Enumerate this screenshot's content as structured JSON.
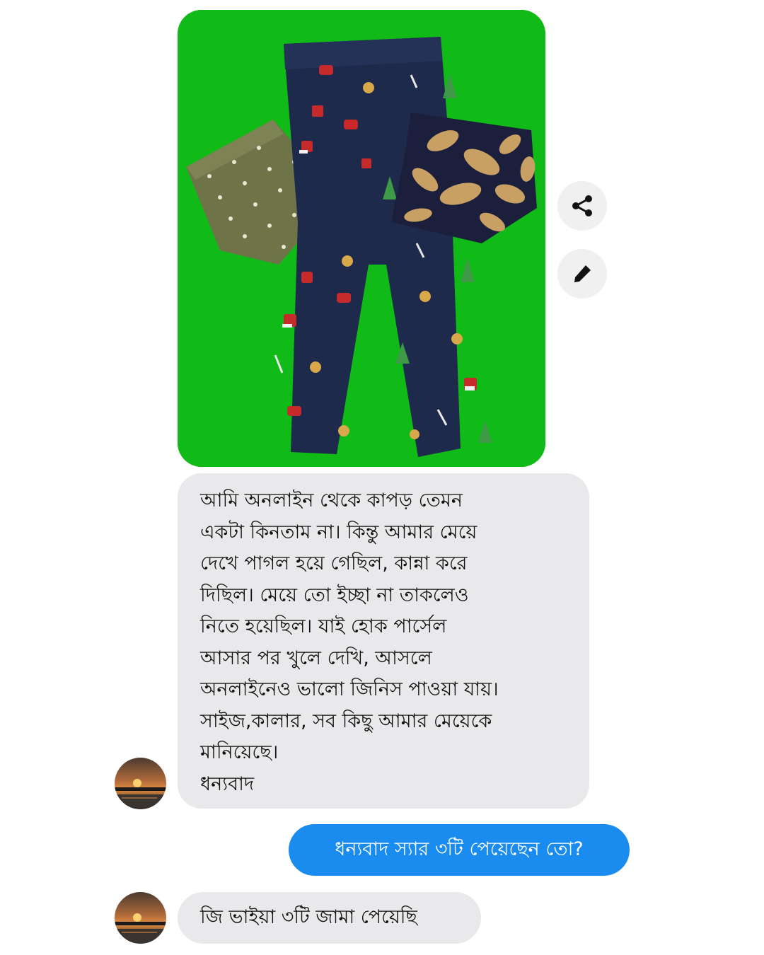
{
  "conversation": {
    "attachment": {
      "icon": "photo-icon"
    },
    "actions": {
      "share_icon": "share-icon",
      "edit_icon": "pencil-icon"
    },
    "messages": [
      {
        "direction": "incoming",
        "lines": [
          "আমি অনলাইন থেকে কাপড় তেমন",
          "একটা কিনতাম না।  কিন্তু আমার মেয়ে",
          "দেখে পাগল হয়ে গেছিল, কান্না করে",
          "দিছিল।  মেয়ে তো ইচ্ছা না তাকলেও",
          "নিতে হয়েছিল।  যাই হোক  পার্সেল",
          "আসার পর খুলে দেখি,  আসলে",
          "অনলাইনেও ভালো জিনিস পাওয়া যায়।",
          "সাইজ,কালার, সব কিছু আমার মেয়েকে",
          "মানিয়েছে।",
          "ধন্যবাদ"
        ]
      },
      {
        "direction": "outgoing",
        "text": "ধন্যবাদ স্যার ৩টি পেয়েছেন তো?"
      },
      {
        "direction": "incoming",
        "text": "জি ভাইয়া ৩টি জামা পেয়েছি"
      }
    ]
  },
  "colors": {
    "incoming_bubble": "#e9e9eb",
    "outgoing_bubble": "#1a8cf0",
    "photo_background": "#12c21a",
    "pants_navy": "#1e2a4c"
  }
}
